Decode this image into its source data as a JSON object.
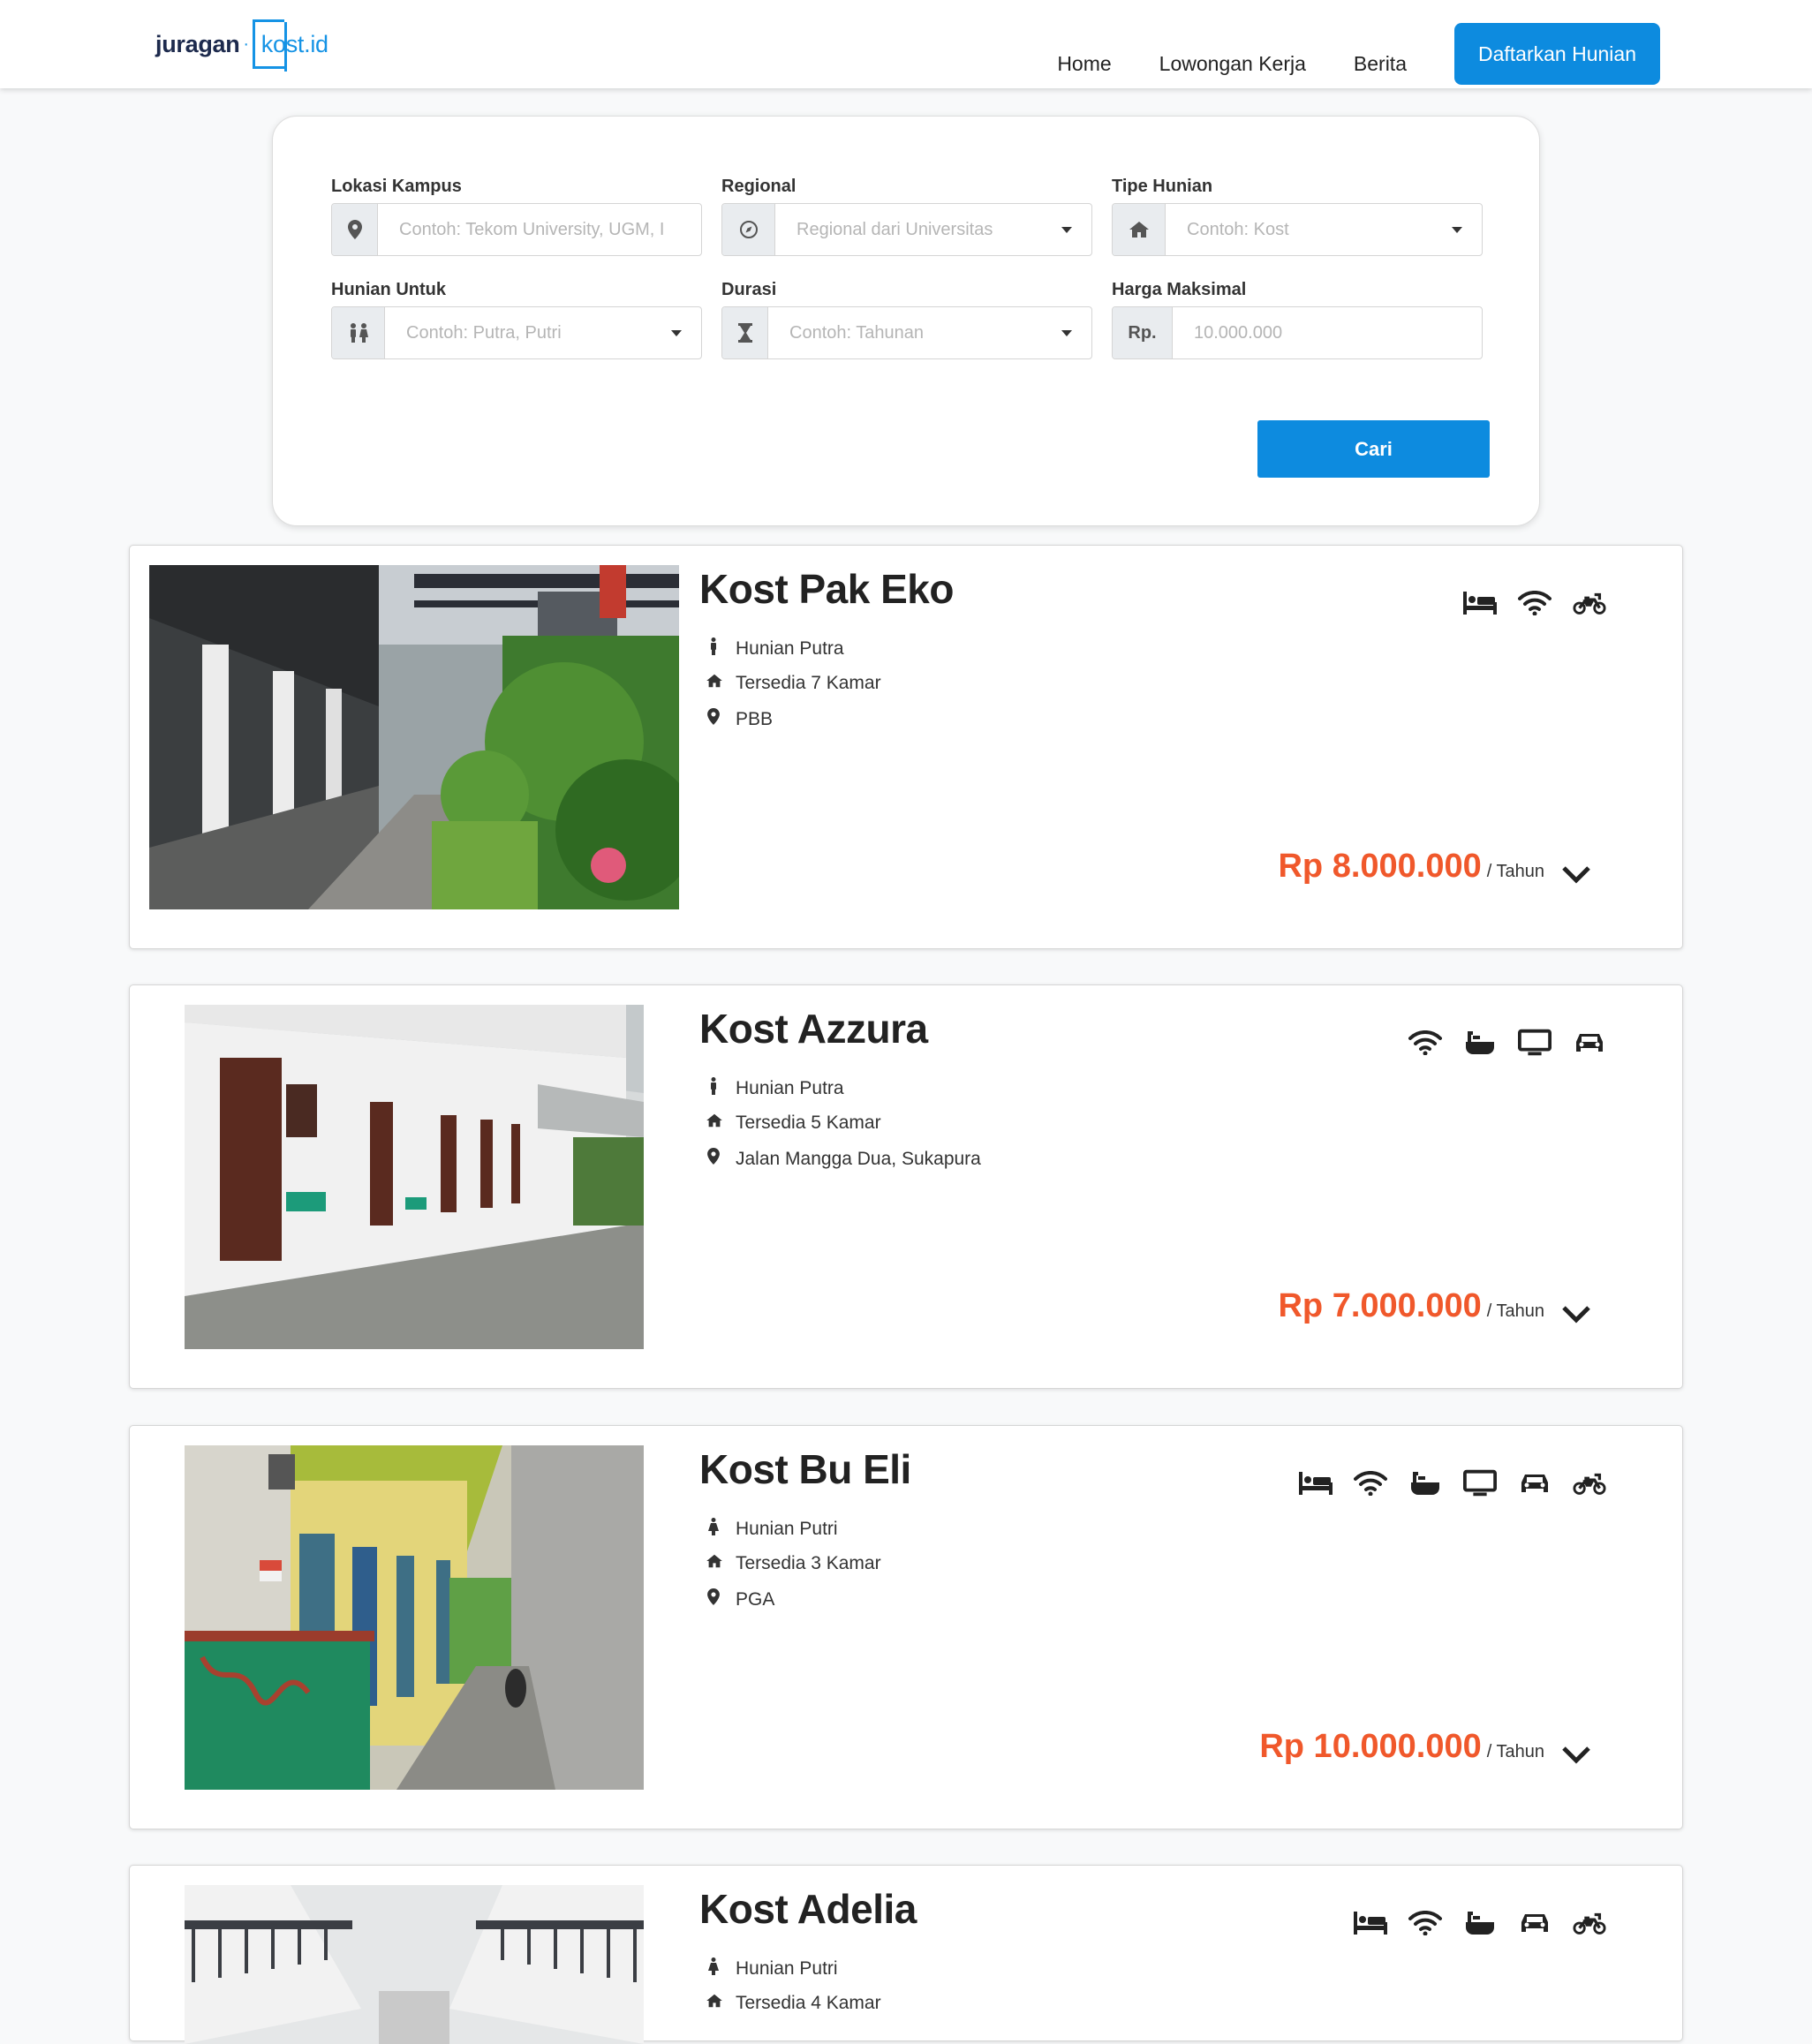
{
  "brand": {
    "part1": "juragan",
    "part2": "kost.id"
  },
  "nav": {
    "items": [
      "Home",
      "Lowongan Kerja",
      "Berita"
    ],
    "cta": "Daftarkan Hunian"
  },
  "search": {
    "fields": [
      {
        "label": "Lokasi Kampus",
        "placeholder": "Contoh: Tekom University, UGM, I",
        "icon": "map-marker-icon",
        "type": "text"
      },
      {
        "label": "Regional",
        "placeholder": "Regional dari Universitas",
        "icon": "compass-icon",
        "type": "select"
      },
      {
        "label": "Tipe Hunian",
        "placeholder": "Contoh: Kost",
        "icon": "home-icon",
        "type": "select"
      },
      {
        "label": "Hunian Untuk",
        "placeholder": "Contoh: Putra, Putri",
        "icon": "people-icon",
        "type": "select"
      },
      {
        "label": "Durasi",
        "placeholder": "Contoh: Tahunan",
        "icon": "hourglass-icon",
        "type": "select"
      },
      {
        "label": "Harga Maksimal",
        "placeholder": "10.000.000",
        "prefix": "Rp.",
        "type": "text"
      }
    ],
    "button": "Cari"
  },
  "listings": [
    {
      "name": "Kost Pak Eko",
      "gender": "Hunian Putra",
      "rooms": "Tersedia 7 Kamar",
      "location": "PBB",
      "price": "Rp 8.000.000",
      "unit": "/ Tahun",
      "amenities": [
        "bed-icon",
        "wifi-icon",
        "motorcycle-icon"
      ]
    },
    {
      "name": "Kost Azzura",
      "gender": "Hunian Putra",
      "rooms": "Tersedia 5 Kamar",
      "location": "Jalan Mangga Dua, Sukapura",
      "price": "Rp 7.000.000",
      "unit": "/ Tahun",
      "amenities": [
        "wifi-icon",
        "bath-icon",
        "tv-icon",
        "car-icon"
      ]
    },
    {
      "name": "Kost Bu Eli",
      "gender": "Hunian Putri",
      "rooms": "Tersedia 3 Kamar",
      "location": "PGA",
      "price": "Rp 10.000.000",
      "unit": "/ Tahun",
      "amenities": [
        "bed-icon",
        "wifi-icon",
        "bath-icon",
        "tv-icon",
        "car-icon",
        "motorcycle-icon"
      ]
    },
    {
      "name": "Kost Adelia",
      "gender": "Hunian Putri",
      "rooms": "Tersedia 4 Kamar",
      "amenities": [
        "bed-icon",
        "wifi-icon",
        "bath-icon",
        "car-icon",
        "motorcycle-icon"
      ]
    }
  ],
  "colors": {
    "primary": "#0d8bdf",
    "price": "#f0582b",
    "logo_dark": "#1d2a4d"
  }
}
